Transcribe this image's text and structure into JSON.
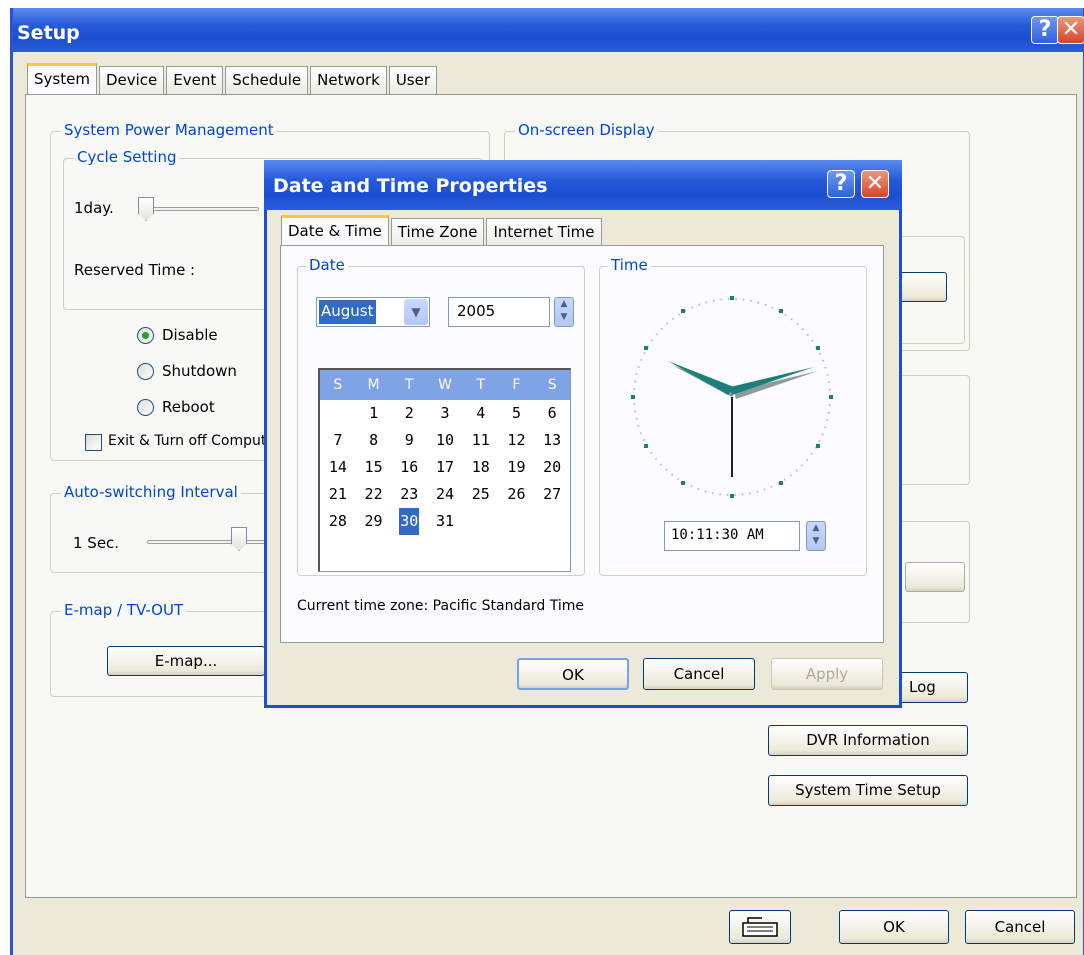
{
  "window": {
    "title": "Setup",
    "help_glyph": "?",
    "close_glyph": "✕"
  },
  "tabs": [
    "System",
    "Device",
    "Event",
    "Schedule",
    "Network",
    "User"
  ],
  "power": {
    "group_label": "System Power Management",
    "cycle_label": "Cycle Setting",
    "day_label": "1day.",
    "reserved_label": "Reserved Time :",
    "radios": [
      {
        "label": "Disable",
        "checked": true
      },
      {
        "label": "Shutdown",
        "checked": false
      },
      {
        "label": "Reboot",
        "checked": false
      }
    ],
    "exit_checkbox": "Exit & Turn off Compute"
  },
  "auto_switch": {
    "group_label": "Auto-switching Interval",
    "value_label": "1 Sec."
  },
  "emap": {
    "group_label": "E-map / TV-OUT",
    "button": "E-map..."
  },
  "osd": {
    "group_label": "On-screen Display"
  },
  "right_buttons": {
    "log": "Log",
    "dvr_info": "DVR Information",
    "time_setup": "System Time Setup"
  },
  "footer": {
    "keyboard_icon": "keyboard-icon",
    "ok": "OK",
    "cancel": "Cancel"
  },
  "dialog": {
    "title": "Date and Time Properties",
    "help_glyph": "?",
    "close_glyph": "✕",
    "tabs": [
      "Date & Time",
      "Time Zone",
      "Internet Time"
    ],
    "date_group": "Date",
    "time_group": "Time",
    "month": "August",
    "year": "2005",
    "weekdays": [
      "S",
      "M",
      "T",
      "W",
      "T",
      "F",
      "S"
    ],
    "weeks": [
      [
        "",
        "1",
        "2",
        "3",
        "4",
        "5",
        "6"
      ],
      [
        "7",
        "8",
        "9",
        "10",
        "11",
        "12",
        "13"
      ],
      [
        "14",
        "15",
        "16",
        "17",
        "18",
        "19",
        "20"
      ],
      [
        "21",
        "22",
        "23",
        "24",
        "25",
        "26",
        "27"
      ],
      [
        "28",
        "29",
        "30",
        "31",
        "",
        "",
        ""
      ]
    ],
    "selected_day": "30",
    "time_value": "10:11:30 AM",
    "timezone_text": "Current time zone:  Pacific Standard Time",
    "ok": "OK",
    "cancel": "Cancel",
    "apply": "Apply"
  },
  "colors": {
    "title_blue": "#1b4fd1",
    "accent_tab": "#ffc83c",
    "group_label": "#0046d5",
    "calendar_header": "#7fa4e6",
    "selection": "#316ac5",
    "clock_hand": "#1d7f7a"
  }
}
